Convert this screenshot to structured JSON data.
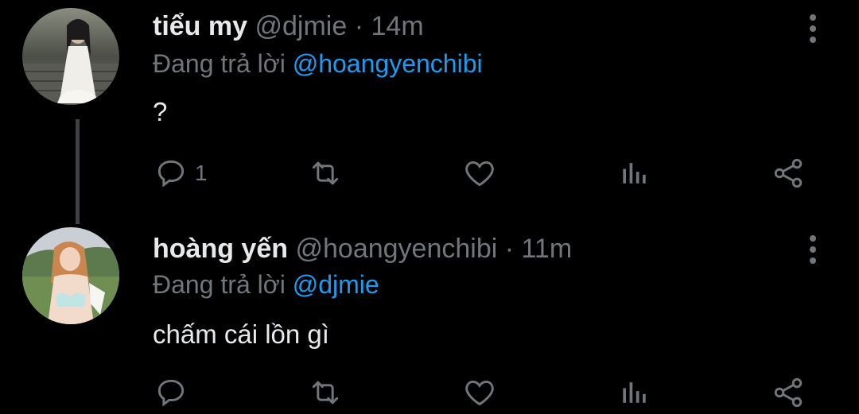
{
  "tweets": [
    {
      "name": "tiểu my",
      "handle": "@djmie",
      "separator": "·",
      "time": "14m",
      "reply_prefix": "Đang trả lời",
      "reply_to": "@hoangyenchibi",
      "text": "?",
      "reply_count": "1",
      "avatar": "avatar-photo"
    },
    {
      "name": "hoàng yến",
      "handle": "@hoangyenchibi",
      "separator": "·",
      "time": "11m",
      "reply_prefix": "Đang trả lời",
      "reply_to": "@djmie",
      "text": "chấm cái lồn gì",
      "reply_count": "",
      "avatar": "avatar-photo"
    }
  ],
  "colors": {
    "background": "#000000",
    "text_primary": "#e7e9ea",
    "text_secondary": "#71767b",
    "accent": "#1d9bf0"
  },
  "icons": {
    "reply": "reply-icon",
    "retweet": "retweet-icon",
    "like": "heart-icon",
    "analytics": "analytics-icon",
    "share": "share-icon",
    "more": "more-vertical-icon"
  }
}
